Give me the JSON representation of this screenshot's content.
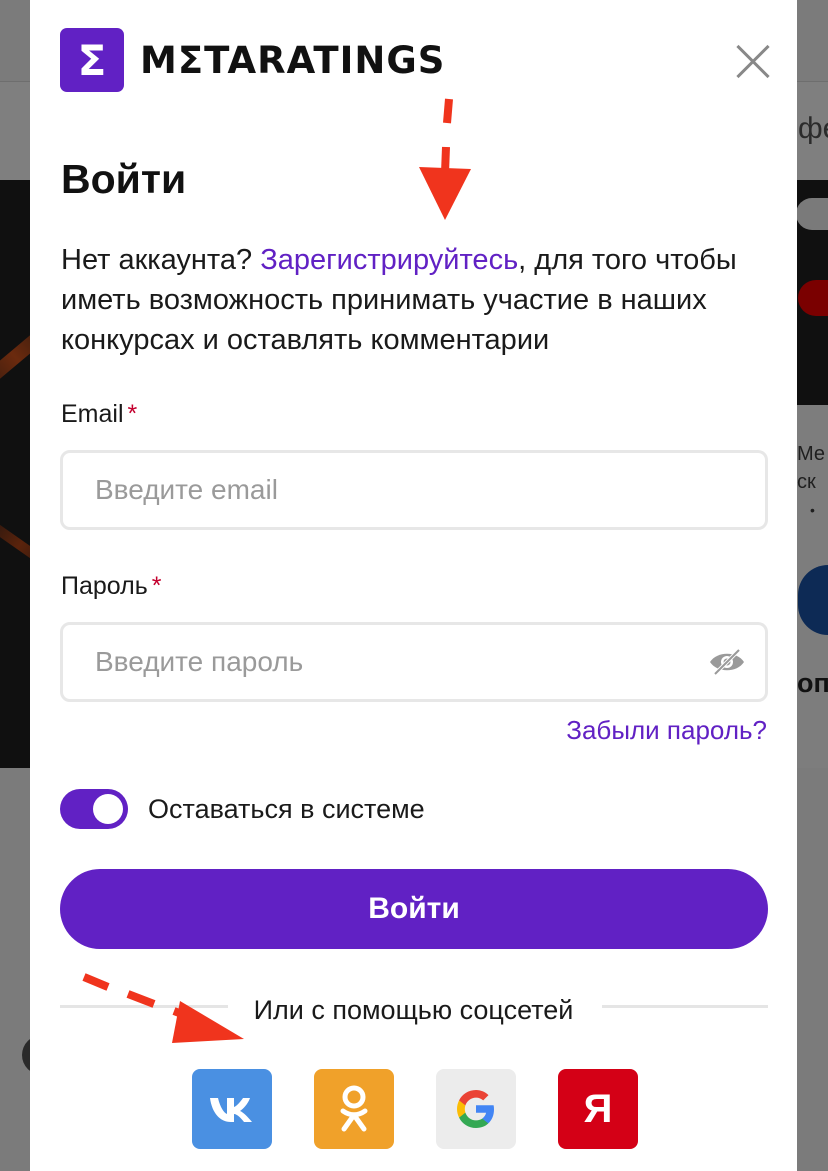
{
  "background": {
    "nav_fragment": "фе",
    "card_lines": [
      "Ме",
      "ск",
      "•"
    ],
    "card_bottom_fragment": "опе"
  },
  "modal": {
    "logo_badge": "Σ",
    "logo_text": "MΣTARATINGS",
    "title": "Войти",
    "intro": {
      "prefix": "Нет аккаунта? ",
      "register_link": "Зарегистрируйтесь",
      "suffix": ", для того чтобы иметь возможность принимать участие в наших конкурсах и оставлять комментарии"
    },
    "email": {
      "label": "Email",
      "required_mark": "*",
      "placeholder": "Введите email",
      "value": ""
    },
    "password": {
      "label": "Пароль",
      "required_mark": "*",
      "placeholder": "Введите пароль",
      "value": ""
    },
    "forgot_link": "Забыли пароль?",
    "remember": {
      "label": "Оставаться в системе",
      "checked": true
    },
    "submit_label": "Войти",
    "social_divider": "Или с помощью соцсетей",
    "social_buttons": [
      {
        "name": "vk",
        "icon": "vk-icon"
      },
      {
        "name": "ok",
        "icon": "odnoklassniki-icon"
      },
      {
        "name": "google",
        "icon": "google-icon"
      },
      {
        "name": "yandex",
        "icon": "yandex-icon",
        "glyph": "Я"
      }
    ]
  },
  "colors": {
    "accent": "#6121c4",
    "annotation_arrow": "#f0341d",
    "vk": "#4a90e2",
    "ok": "#f0a12a",
    "yandex": "#d40016"
  }
}
